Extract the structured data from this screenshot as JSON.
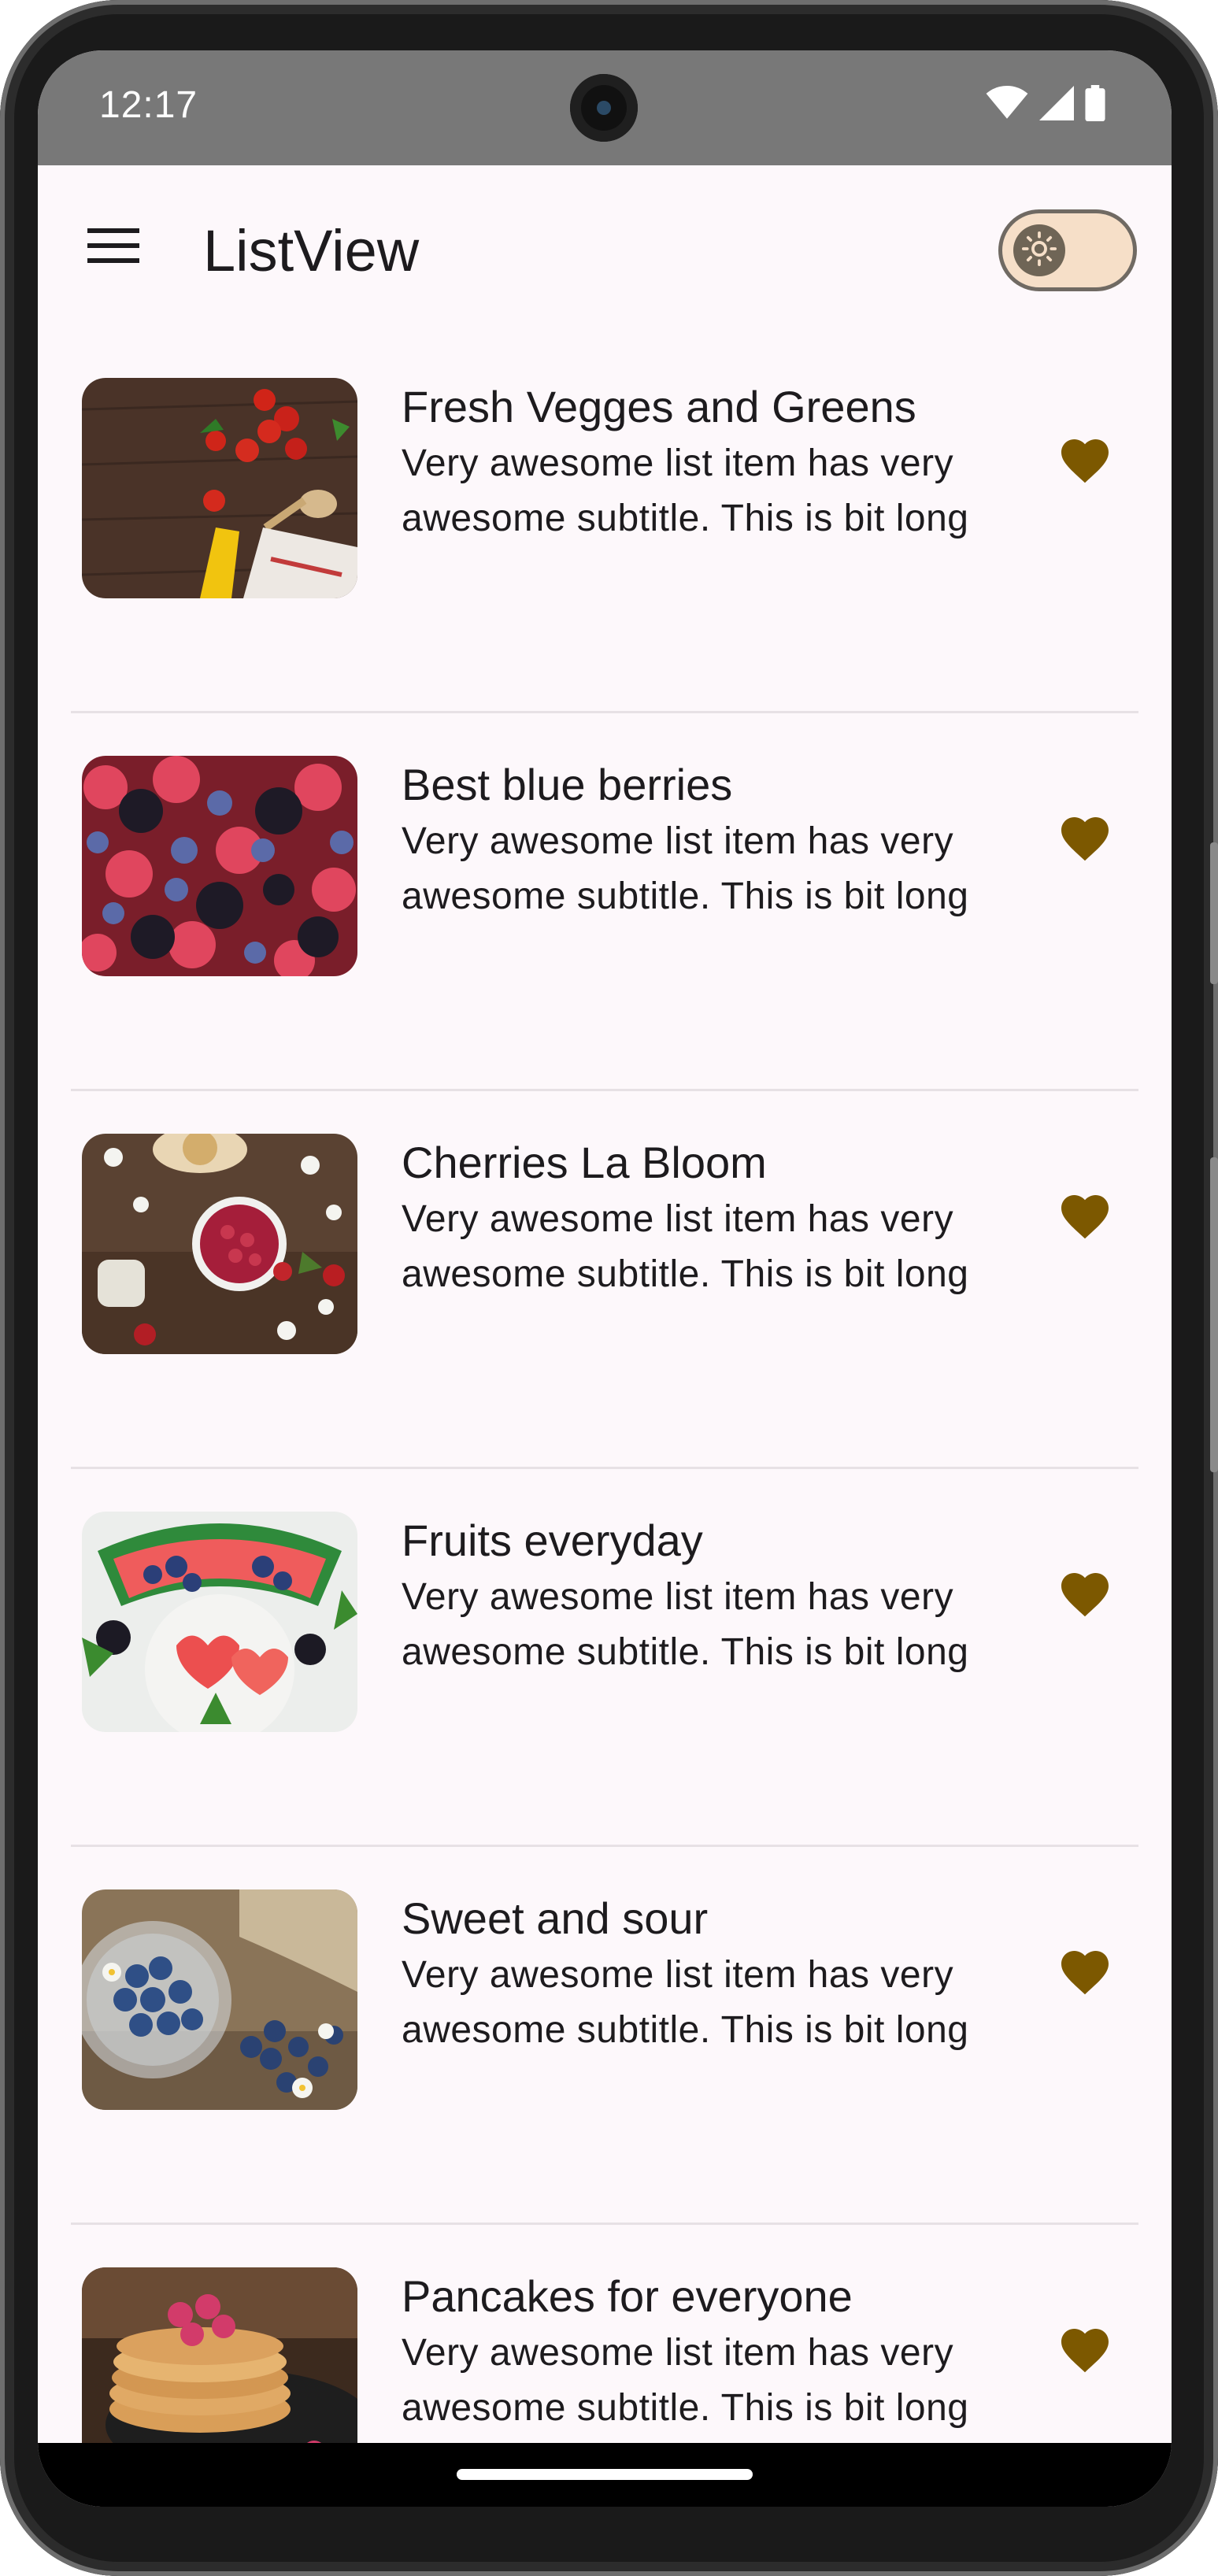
{
  "status_bar": {
    "time": "12:17"
  },
  "app_bar": {
    "title": "ListView",
    "theme_toggle": "light"
  },
  "colors": {
    "accent": "#7c5800",
    "surface": "#fdf8fb",
    "status_bar": "#787878",
    "switch_track": "#f6dfc8"
  },
  "items": [
    {
      "title": "Fresh Vegges and Greens",
      "subtitle": "Very awesome list item has very awesome subtitle. This is bit long",
      "icon": "heart-icon",
      "favorite": true
    },
    {
      "title": "Best blue berries",
      "subtitle": "Very awesome list item has very awesome subtitle. This is bit long",
      "icon": "heart-icon",
      "favorite": true
    },
    {
      "title": "Cherries La Bloom",
      "subtitle": "Very awesome list item has very awesome subtitle. This is bit long",
      "icon": "heart-icon",
      "favorite": true
    },
    {
      "title": "Fruits everyday",
      "subtitle": "Very awesome list item has very awesome subtitle. This is bit long",
      "icon": "heart-icon",
      "favorite": true
    },
    {
      "title": "Sweet and sour",
      "subtitle": "Very awesome list item has very awesome subtitle. This is bit long",
      "icon": "heart-icon",
      "favorite": true
    },
    {
      "title": "Pancakes for everyone",
      "subtitle": "Very awesome list item has very awesome subtitle. This is bit long",
      "icon": "heart-icon",
      "favorite": true
    }
  ]
}
